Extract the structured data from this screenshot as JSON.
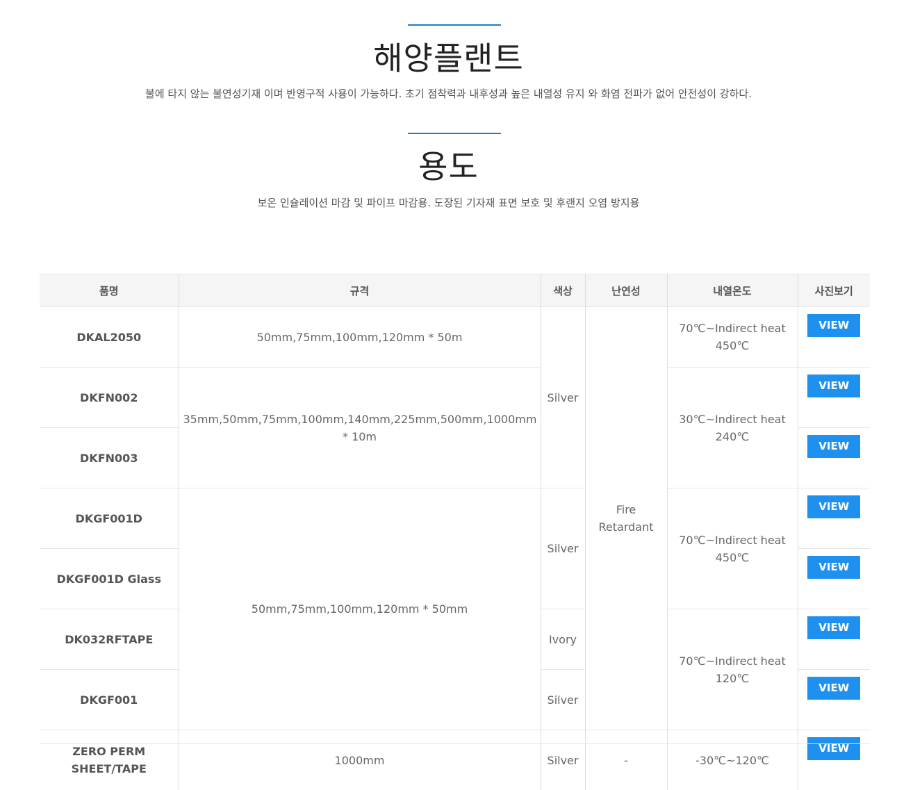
{
  "section1": {
    "title": "해양플랜트",
    "desc": "불에 타지 않는 불연성기재 이며 반영구적 사용이 가능하다. 초기 점착력과 내후성과 높은 내열성 유지 와 화염 전파가 없어 안전성이 강하다."
  },
  "section2": {
    "title": "용도",
    "desc": "보온 인슐레이션 마감 및 파이프 마감용. 도장된 기자재 표면 보호 및 후랜지 오염 방지용"
  },
  "table": {
    "headers": [
      "품명",
      "규격",
      "색상",
      "난연성",
      "내열온도",
      "사진보기"
    ],
    "names": [
      "DKAL2050",
      "DKFN002",
      "DKFN003",
      "DKGF001D",
      "DKGF001D Glass",
      "DK032RFTAPE",
      "DKGF001",
      "ZERO PERM SHEET/TAPE"
    ],
    "specs": [
      "50mm,75mm,100mm,120mm * 50m",
      "35mm,50mm,75mm,100mm,140mm,225mm,500mm,1000mm * 10m",
      "50mm,75mm,100mm,120mm * 50mm",
      "1000mm"
    ],
    "colors": [
      "Silver",
      "Silver",
      "Ivory",
      "Silver",
      "Silver"
    ],
    "flame": [
      "Fire Retardant",
      "-"
    ],
    "heat": [
      "70℃~Indirect heat 450℃",
      "30℃~Indirect heat 240℃",
      "70℃~Indirect heat 450℃",
      "70℃~Indirect heat 120℃",
      "-30℃~120℃"
    ],
    "view_label": "VIEW"
  }
}
